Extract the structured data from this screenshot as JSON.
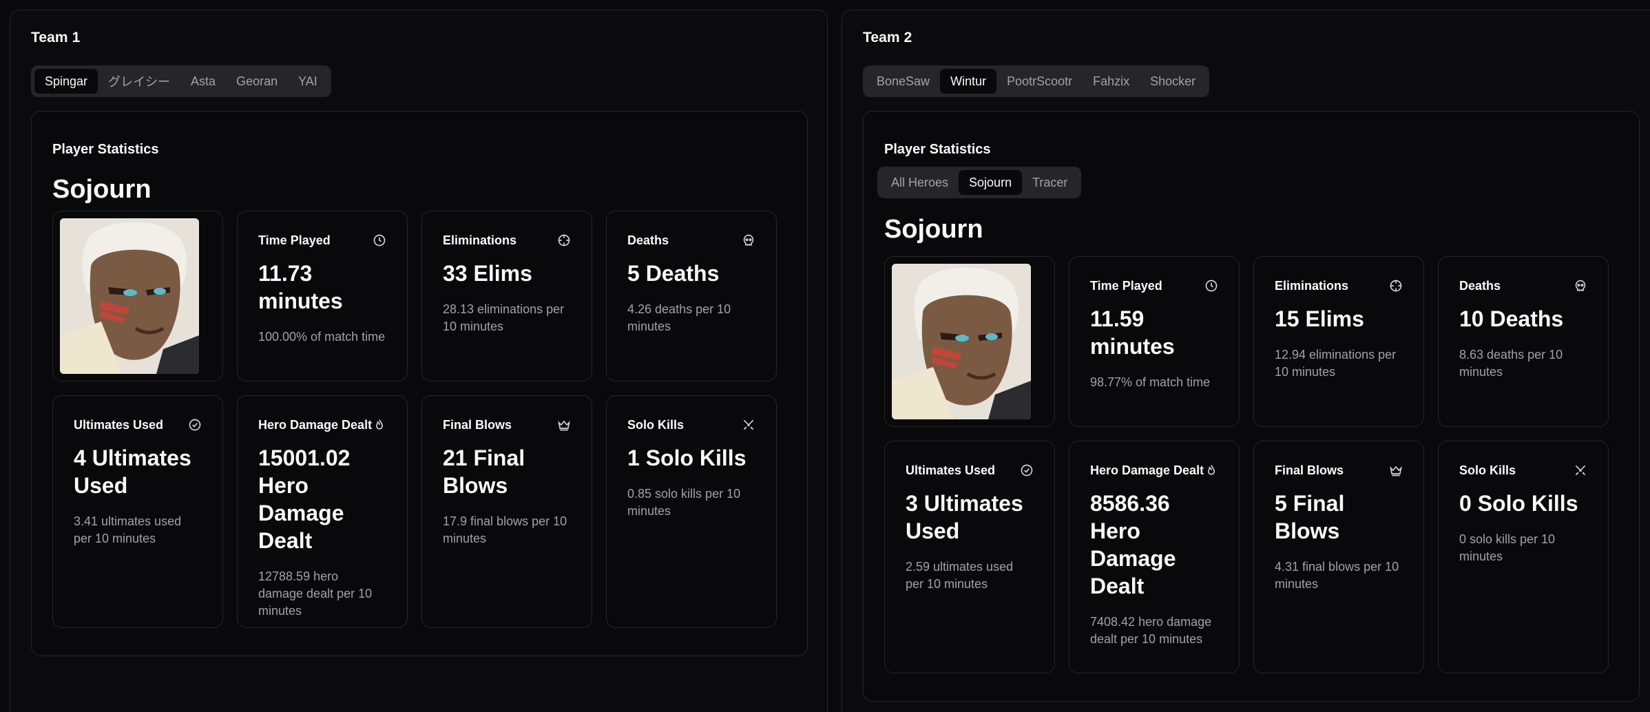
{
  "team1": {
    "title": "Team 1",
    "players": [
      "Spingar",
      "グレイシー",
      "Asta",
      "Georan",
      "YAI"
    ],
    "active_player": "Spingar",
    "panel_title": "Player Statistics",
    "hero_name": "Sojourn",
    "stats": {
      "time_played": {
        "label": "Time Played",
        "value": "11.73 minutes",
        "sub": "100.00% of match time"
      },
      "eliminations": {
        "label": "Eliminations",
        "value": "33 Elims",
        "sub": "28.13 eliminations per 10 minutes"
      },
      "deaths": {
        "label": "Deaths",
        "value": "5 Deaths",
        "sub": "4.26 deaths per 10 minutes"
      },
      "ultimates": {
        "label": "Ultimates Used",
        "value": "4 Ultimates Used",
        "sub": "3.41 ultimates used per 10 minutes"
      },
      "hero_damage": {
        "label": "Hero Damage Dealt",
        "value": "15001.02 Hero Damage Dealt",
        "sub": "12788.59 hero damage dealt per 10 minutes"
      },
      "final_blows": {
        "label": "Final Blows",
        "value": "21 Final Blows",
        "sub": "17.9 final blows per 10 minutes"
      },
      "solo_kills": {
        "label": "Solo Kills",
        "value": "1 Solo Kills",
        "sub": "0.85 solo kills per 10 minutes"
      }
    }
  },
  "team2": {
    "title": "Team 2",
    "players": [
      "BoneSaw",
      "Wintur",
      "PootrScootr",
      "Fahzix",
      "Shocker"
    ],
    "active_player": "Wintur",
    "panel_title": "Player Statistics",
    "hero_tabs": [
      "All Heroes",
      "Sojourn",
      "Tracer"
    ],
    "active_hero_tab": "Sojourn",
    "hero_name": "Sojourn",
    "stats": {
      "time_played": {
        "label": "Time Played",
        "value": "11.59 minutes",
        "sub": "98.77% of match time"
      },
      "eliminations": {
        "label": "Eliminations",
        "value": "15 Elims",
        "sub": "12.94 eliminations per 10 minutes"
      },
      "deaths": {
        "label": "Deaths",
        "value": "10 Deaths",
        "sub": "8.63 deaths per 10 minutes"
      },
      "ultimates": {
        "label": "Ultimates Used",
        "value": "3 Ultimates Used",
        "sub": "2.59 ultimates used per 10 minutes"
      },
      "hero_damage": {
        "label": "Hero Damage Dealt",
        "value": "8586.36 Hero Damage Dealt",
        "sub": "7408.42 hero damage dealt per 10 minutes"
      },
      "final_blows": {
        "label": "Final Blows",
        "value": "5 Final Blows",
        "sub": "4.31 final blows per 10 minutes"
      },
      "solo_kills": {
        "label": "Solo Kills",
        "value": "0 Solo Kills",
        "sub": "0 solo kills per 10 minutes"
      }
    }
  },
  "icons": {
    "time_played": "clock-icon",
    "eliminations": "crosshair-icon",
    "deaths": "skull-icon",
    "ultimates": "check-circle-icon",
    "hero_damage": "flame-icon",
    "final_blows": "crown-icon",
    "solo_kills": "swords-icon"
  },
  "colors": {
    "background": "#0a0a0c",
    "border": "#27272a",
    "tab_bg": "#26262a",
    "muted_text": "#a1a1aa"
  }
}
